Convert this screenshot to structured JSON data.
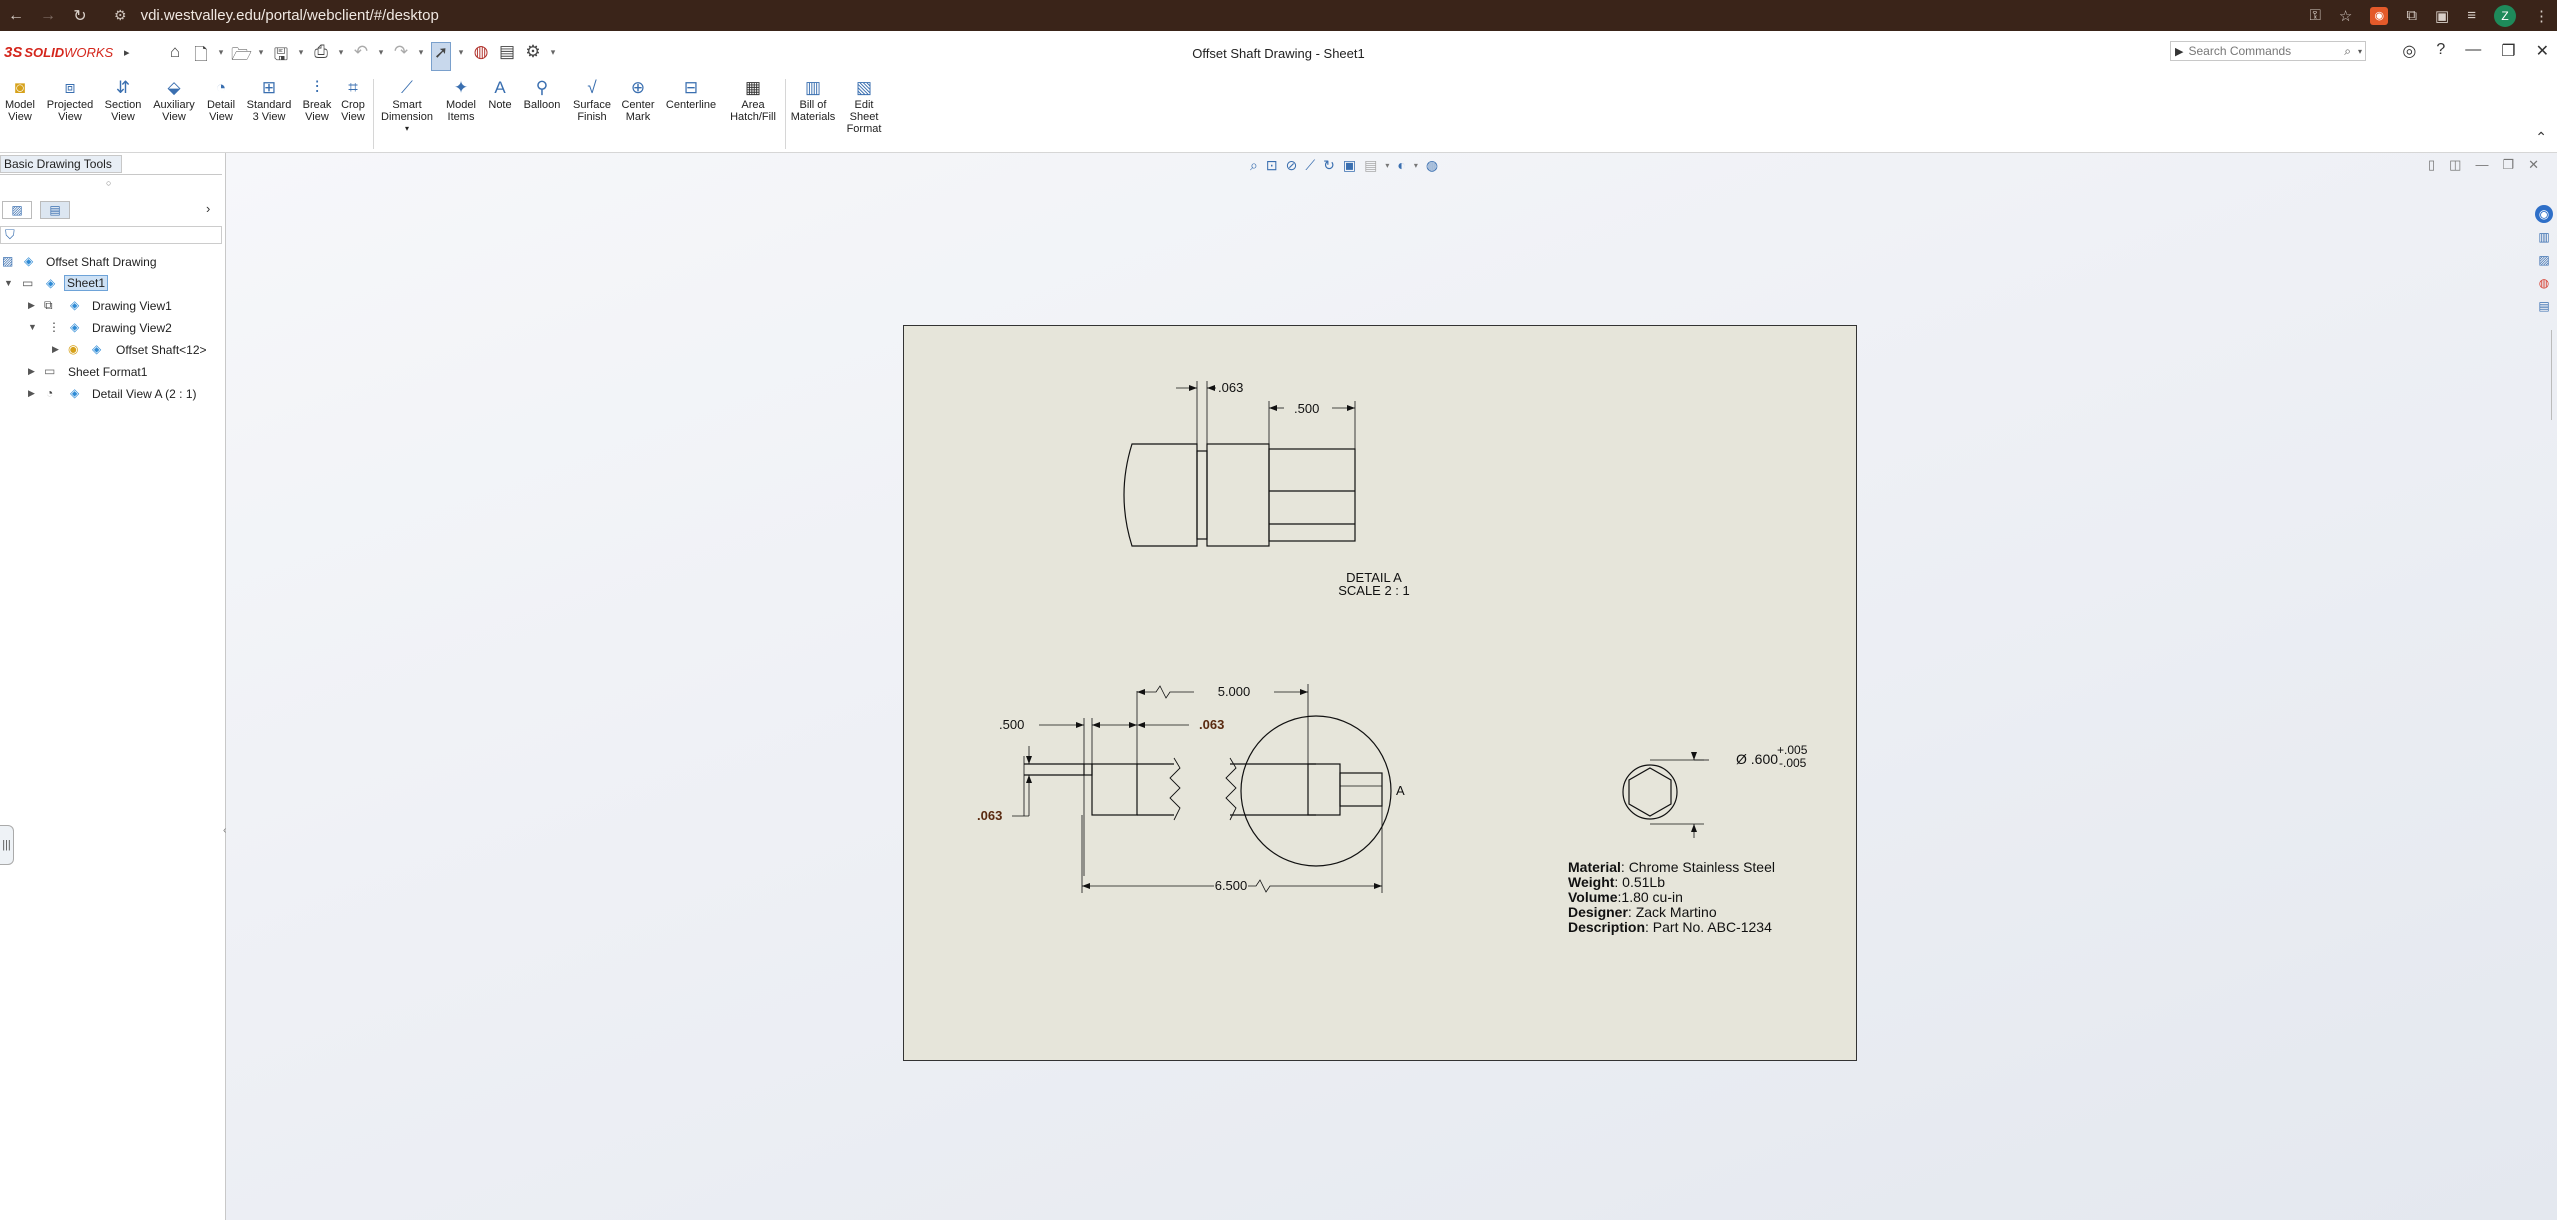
{
  "browser": {
    "url": "vdi.westvalley.edu/portal/webclient/#/desktop",
    "avatar_letter": "Z"
  },
  "app": {
    "logo_ds": "3S",
    "logo_solid": "SOLID",
    "logo_works": "WORKS",
    "doc_title": "Offset Shaft Drawing - Sheet1",
    "search_placeholder": "Search Commands"
  },
  "ribbon": [
    {
      "l1": "Model",
      "l2": "View"
    },
    {
      "l1": "Projected",
      "l2": "View"
    },
    {
      "l1": "Section",
      "l2": "View"
    },
    {
      "l1": "Auxiliary",
      "l2": "View"
    },
    {
      "l1": "Detail",
      "l2": "View"
    },
    {
      "l1": "Standard",
      "l2": "3 View"
    },
    {
      "l1": "Break",
      "l2": "View"
    },
    {
      "l1": "Crop",
      "l2": "View"
    },
    {
      "l1": "Smart",
      "l2": "Dimension"
    },
    {
      "l1": "Model",
      "l2": "Items"
    },
    {
      "l1": "Note",
      "l2": ""
    },
    {
      "l1": "Balloon",
      "l2": ""
    },
    {
      "l1": "Surface",
      "l2": "Finish"
    },
    {
      "l1": "Center",
      "l2": "Mark"
    },
    {
      "l1": "Centerline",
      "l2": ""
    },
    {
      "l1": "Area",
      "l2": "Hatch/Fill"
    },
    {
      "l1": "Bill of",
      "l2": "Materials"
    },
    {
      "l1": "Edit",
      "l2": "Sheet",
      "l3": "Format"
    }
  ],
  "left_panel": {
    "tab_label": "Basic Drawing Tools",
    "tree": [
      {
        "label": "Offset Shaft Drawing"
      },
      {
        "label": "Sheet1"
      },
      {
        "label": "Drawing View1"
      },
      {
        "label": "Drawing View2"
      },
      {
        "label": "Offset Shaft<12>"
      },
      {
        "label": "Sheet Format1"
      },
      {
        "label": "Detail View A (2 : 1)"
      }
    ]
  },
  "drawing": {
    "dims": {
      "top_063": ".063",
      "top_500": ".500",
      "left_500": ".500",
      "mid_063": ".063",
      "left_063": ".063",
      "top_5000": "5.000",
      "bottom_6500": "6.500",
      "dia": "Ø .600",
      "tol_plus": "+.005",
      "tol_minus": "-.005",
      "detail_letter": "A"
    },
    "detail_label": "DETAIL A",
    "detail_scale": "SCALE 2 : 1",
    "note": {
      "material_k": "Material",
      "material_v": ": Chrome Stainless Steel",
      "weight_k": "Weight",
      "weight_v": ": 0.51Lb",
      "volume_k": "Volume",
      "volume_v": ":1.80 cu-in",
      "designer_k": "Designer",
      "designer_v": ": Zack Martino",
      "description_k": "Description",
      "description_v": ": Part No. ABC-1234"
    }
  }
}
